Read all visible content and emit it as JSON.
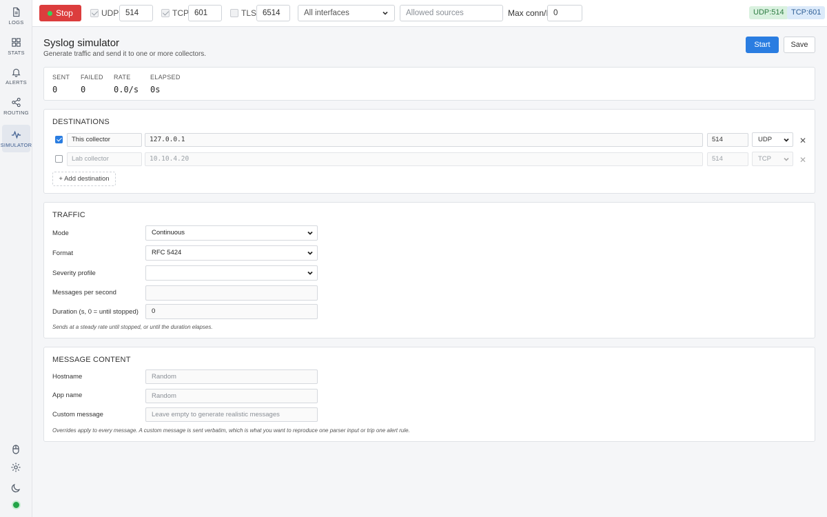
{
  "sidebar": {
    "items": [
      {
        "label": "LOGS",
        "icon": "file-text-icon"
      },
      {
        "label": "STATS",
        "icon": "grid-icon"
      },
      {
        "label": "ALERTS",
        "icon": "bell-icon"
      },
      {
        "label": "ROUTING",
        "icon": "share-icon"
      },
      {
        "label": "SIMULATOR",
        "icon": "activity-icon"
      }
    ],
    "bottom_icons": [
      "mouse-icon",
      "gear-icon",
      "moon-icon"
    ],
    "status_color": "#22a447"
  },
  "topbar": {
    "stop_label": "Stop",
    "udp": {
      "label": "UDP",
      "port": "514",
      "checked": true
    },
    "tcp": {
      "label": "TCP",
      "port": "601",
      "checked": true
    },
    "tls": {
      "label": "TLS",
      "port": "6514",
      "checked": false
    },
    "interface_select": "All interfaces",
    "allowed_sources_placeholder": "Allowed sources",
    "max_conn_label": "Max conn/IP",
    "max_conn_value": "0",
    "badges": {
      "udp": "UDP:514",
      "tcp": "TCP:601"
    }
  },
  "page": {
    "title": "Syslog simulator",
    "subtitle": "Generate traffic and send it to one or more collectors.",
    "start_label": "Start",
    "save_label": "Save"
  },
  "stats": {
    "sent": {
      "label": "SENT",
      "value": "0"
    },
    "failed": {
      "label": "FAILED",
      "value": "0"
    },
    "rate": {
      "label": "RATE",
      "value": "0.0/s"
    },
    "elapsed": {
      "label": "ELAPSED",
      "value": "0s"
    }
  },
  "destinations": {
    "title": "DESTINATIONS",
    "rows": [
      {
        "checked": true,
        "name": "This collector",
        "host": "127.0.0.1",
        "port": "514",
        "protocol": "UDP"
      },
      {
        "checked": false,
        "name": "Lab collector",
        "host": "10.10.4.20",
        "port": "514",
        "protocol": "TCP"
      }
    ],
    "add_label": "+ Add destination"
  },
  "traffic": {
    "title": "TRAFFIC",
    "mode": {
      "label": "Mode",
      "value": "Continuous"
    },
    "format": {
      "label": "Format",
      "value": "RFC 5424"
    },
    "severity": {
      "label": "Severity profile",
      "value": ""
    },
    "mps": {
      "label": "Messages per second",
      "value": ""
    },
    "duration": {
      "label": "Duration (s, 0 = until stopped)",
      "value": "0"
    },
    "hint": "Sends at a steady rate until stopped, or until the duration elapses."
  },
  "content": {
    "title": "MESSAGE CONTENT",
    "hostname": {
      "label": "Hostname",
      "placeholder": "Random"
    },
    "app_name": {
      "label": "App name",
      "placeholder": "Random"
    },
    "custom": {
      "label": "Custom message",
      "placeholder": "Leave empty to generate realistic messages"
    },
    "hint": "Overrides apply to every message. A custom message is sent verbatim, which is what you want to reproduce one parser input or trip one alert rule."
  },
  "colors": {
    "accent": "#2a7de1",
    "danger": "#dc3d3d",
    "udp_badge": "#d9f1df",
    "tcp_badge": "#dceafa"
  }
}
